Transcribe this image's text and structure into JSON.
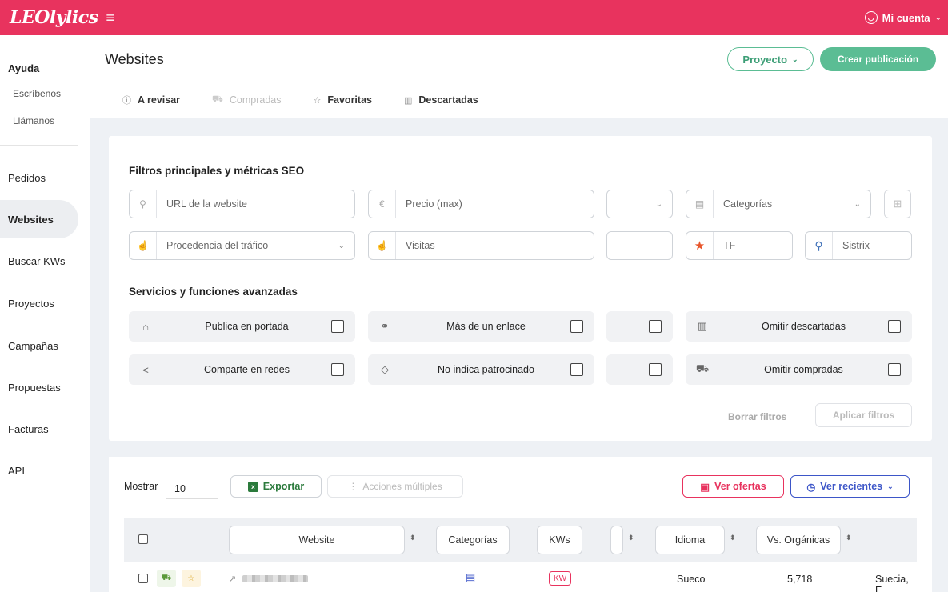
{
  "app": {
    "logo": "LEOlylics",
    "account_label": "Mi cuenta"
  },
  "sidebar": {
    "help_title": "Ayuda",
    "help_items": [
      "Escríbenos",
      "Llámanos"
    ],
    "items": [
      {
        "label": "Pedidos",
        "active": false
      },
      {
        "label": "Websites",
        "active": true
      },
      {
        "label": "Buscar KWs",
        "active": false
      },
      {
        "label": "Proyectos",
        "active": false
      },
      {
        "label": "Campañas",
        "active": false
      },
      {
        "label": "Propuestas",
        "active": false
      },
      {
        "label": "Facturas",
        "active": false
      },
      {
        "label": "API",
        "active": false
      }
    ]
  },
  "header": {
    "title": "Websites",
    "project_button": "Proyecto",
    "create_button": "Crear publicación"
  },
  "tabs": [
    {
      "label": "A revisar",
      "icon": "info-icon",
      "disabled": false
    },
    {
      "label": "Compradas",
      "icon": "cart-icon",
      "disabled": true
    },
    {
      "label": "Favoritas",
      "icon": "star-icon",
      "disabled": false
    },
    {
      "label": "Descartadas",
      "icon": "trash-icon",
      "disabled": false
    }
  ],
  "filters": {
    "title": "Filtros principales y métricas SEO",
    "url_placeholder": "URL de la website",
    "price_placeholder": "Precio (max)",
    "categories_placeholder": "Categorías",
    "traffic_placeholder": "Procedencia del tráfico",
    "visits_placeholder": "Visitas",
    "tf_placeholder": "TF",
    "sistrix_placeholder": "Sistrix"
  },
  "services": {
    "title": "Servicios y funciones avanzadas",
    "items": [
      {
        "label": "Publica en portada",
        "icon": "home-icon"
      },
      {
        "label": "Más de un enlace",
        "icon": "link-icon"
      },
      {
        "label": "Omitir descartadas",
        "icon": "trash-icon"
      },
      {
        "label": "Comparte en redes",
        "icon": "share-icon"
      },
      {
        "label": "No indica patrocinado",
        "icon": "tag-icon"
      },
      {
        "label": "Omitir compradas",
        "icon": "cart-icon"
      }
    ],
    "clear_label": "Borrar filtros",
    "apply_label": "Aplicar filtros"
  },
  "results": {
    "show_label": "Mostrar",
    "show_value": "10",
    "export_label": "Exportar",
    "multi_label": "Acciones múltiples",
    "offers_label": "Ver ofertas",
    "recent_label": "Ver recientes",
    "columns": [
      "Website",
      "Categorías",
      "KWs",
      "Idioma",
      "Vs. Orgánicas"
    ],
    "rows": [
      {
        "kw_badge": "KW",
        "language": "Sueco",
        "organic": "5,718",
        "country": "Suecia, E"
      }
    ]
  },
  "colors": {
    "brand": "#e8335e",
    "accent_green": "#5bbd94",
    "accent_blue": "#3d56c8"
  }
}
